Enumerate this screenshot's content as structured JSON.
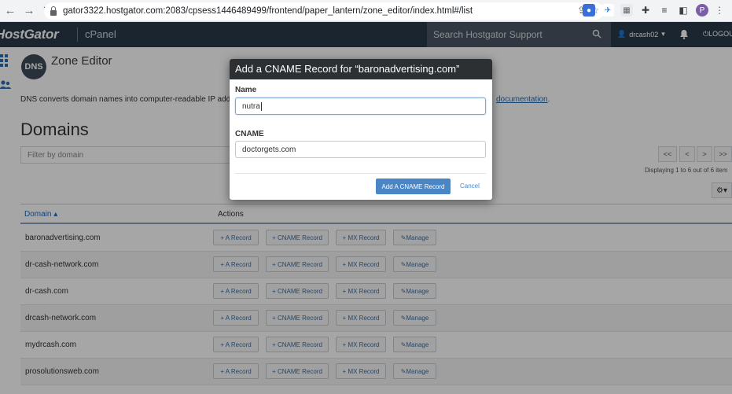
{
  "browser": {
    "url": "gator3322.hostgator.com:2083/cpsess1446489499/frontend/paper_lantern/zone_editor/index.html#/list",
    "profile_initial": "P"
  },
  "header": {
    "brand": "HostGator",
    "product": "cPanel",
    "support_search_placeholder": "Search Hostgator Support",
    "username": "drcash02",
    "logout": "LOGOUT"
  },
  "page": {
    "icon_text": "DNS",
    "title": "Zone Editor",
    "description": "DNS converts domain names into computer-readable IP addr",
    "description_link": "documentation",
    "description_end": ".",
    "domains_heading": "Domains",
    "filter_placeholder": "Filter by domain",
    "pager": [
      "<<",
      "<",
      ">",
      ">>"
    ],
    "displaying": "Displaying 1 to 6 out of 6 item"
  },
  "table": {
    "col_domain": "Domain",
    "col_actions": "Actions",
    "actions": [
      "+ A Record",
      "+ CNAME Record",
      "+ MX Record",
      "Manage"
    ],
    "rows": [
      "baronadvertising.com",
      "dr-cash-network.com",
      "dr-cash.com",
      "drcash-network.com",
      "mydrcash.com",
      "prosolutionsweb.com"
    ]
  },
  "modal": {
    "title": "Add a CNAME Record for “baronadvertising.com”",
    "name_label": "Name",
    "name_value": "nutra",
    "cname_label": "CNAME",
    "cname_value": "doctorgets.com",
    "submit": "Add A CNAME Record",
    "cancel": "Cancel"
  },
  "colors": {
    "header_bg": "#293a4a",
    "modal_header": "#2d3033",
    "primary": "#4a86c5",
    "link": "#1f6bb4"
  }
}
